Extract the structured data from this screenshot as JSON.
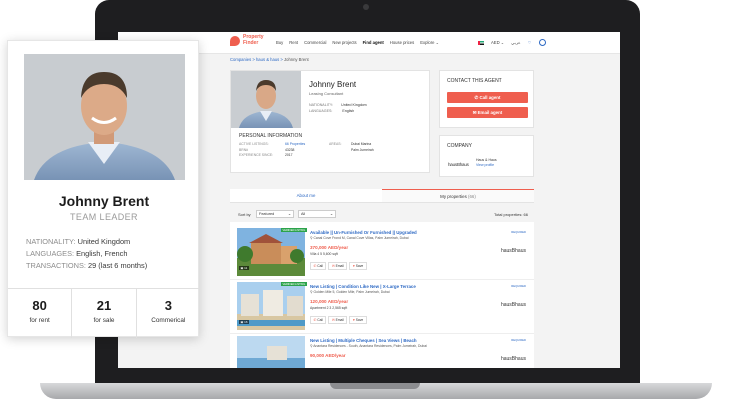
{
  "nav": {
    "logo_text": "Property Finder",
    "links": [
      "Buy",
      "Rent",
      "Commercial",
      "New projects",
      "Find agent",
      "House prices",
      "Explore ⌄"
    ],
    "active_index": 4,
    "currency": "AED ⌄",
    "language": "عربي"
  },
  "breadcrumb": {
    "path": "Companies > haus & haus >",
    "current": "Johnny Brent"
  },
  "profile": {
    "name": "Johnny Brent",
    "role": "Leasing Consultant",
    "nationality_label": "NATIONALITY:",
    "nationality": "United Kingdom",
    "languages_label": "LANGUAGES:",
    "languages": "English",
    "personal_info_title": "PERSONAL INFORMATION",
    "active_listings_label": "ACTIVE LISTINGS:",
    "active_listings": "66 Properties",
    "brn_label": "BRN#",
    "brn": "43238",
    "experience_label": "EXPERIENCE SINCE:",
    "experience": "2017",
    "areas_label": "AREAS:",
    "areas": [
      "Dubai Marina",
      "Palm Jumeirah"
    ]
  },
  "contact": {
    "title": "CONTACT THIS AGENT",
    "call_label": "Call agent",
    "email_label": "Email agent"
  },
  "company": {
    "title": "COMPANY",
    "logo": "hausBhaus",
    "name": "Haus & Haus",
    "link": "View profile"
  },
  "tabs": {
    "about": "About me",
    "properties": "My properties",
    "count": "(66)"
  },
  "sort": {
    "label": "Sort by",
    "value": "Featured",
    "filter": "All",
    "total": "Total properties: 66"
  },
  "listings": [
    {
      "title": "Available || Un-Furnished Or Furnished || Upgraded",
      "location": "Canal Cove Frond M, Canal Cove Villas, Palm Jumeirah, Dubai",
      "price": "370,000 AED/year",
      "meta": "Villa  4  5  5,600 sqft",
      "photos": "11",
      "badge": "REQUIRED",
      "verified": "VERIFIED LISTING"
    },
    {
      "title": "New Listing | Condition Like New | X-Large Terrace",
      "location": "Golden Mile 5, Golden Mile, Palm Jumeirah, Dubai",
      "price": "120,000 AED/year",
      "meta": "Apartment  2  3  2,565 sqft",
      "photos": "16",
      "badge": "REQUIRED",
      "verified": "VERIFIED LISTING"
    },
    {
      "title": "New Listing | Multiple Cheques | Sea Views | Beach",
      "location": "Anantara Residences - South, Anantara Residences, Palm Jumeirah, Dubai",
      "price": "90,000 AED/year",
      "meta": "",
      "photos": "",
      "badge": "REQUIRED",
      "verified": ""
    }
  ],
  "listing_buttons": {
    "call": "Call",
    "email": "Email",
    "save": "Save"
  },
  "listing_brand": "hausBhaus",
  "card": {
    "name": "Johnny Brent",
    "role": "TEAM LEADER",
    "nationality_label": "NATIONALITY:",
    "nationality": "United Kingdom",
    "languages_label": "LANGUAGES:",
    "languages": "English, French",
    "transactions_label": "TRANSACTIONS:",
    "transactions": "29 (last 6 months)",
    "stats": [
      {
        "num": "80",
        "label": "for rent"
      },
      {
        "num": "21",
        "label": "for sale"
      },
      {
        "num": "3",
        "label": "Commerical"
      }
    ]
  },
  "colors": {
    "brand": "#ef5e4e",
    "link": "#2d69c4"
  }
}
